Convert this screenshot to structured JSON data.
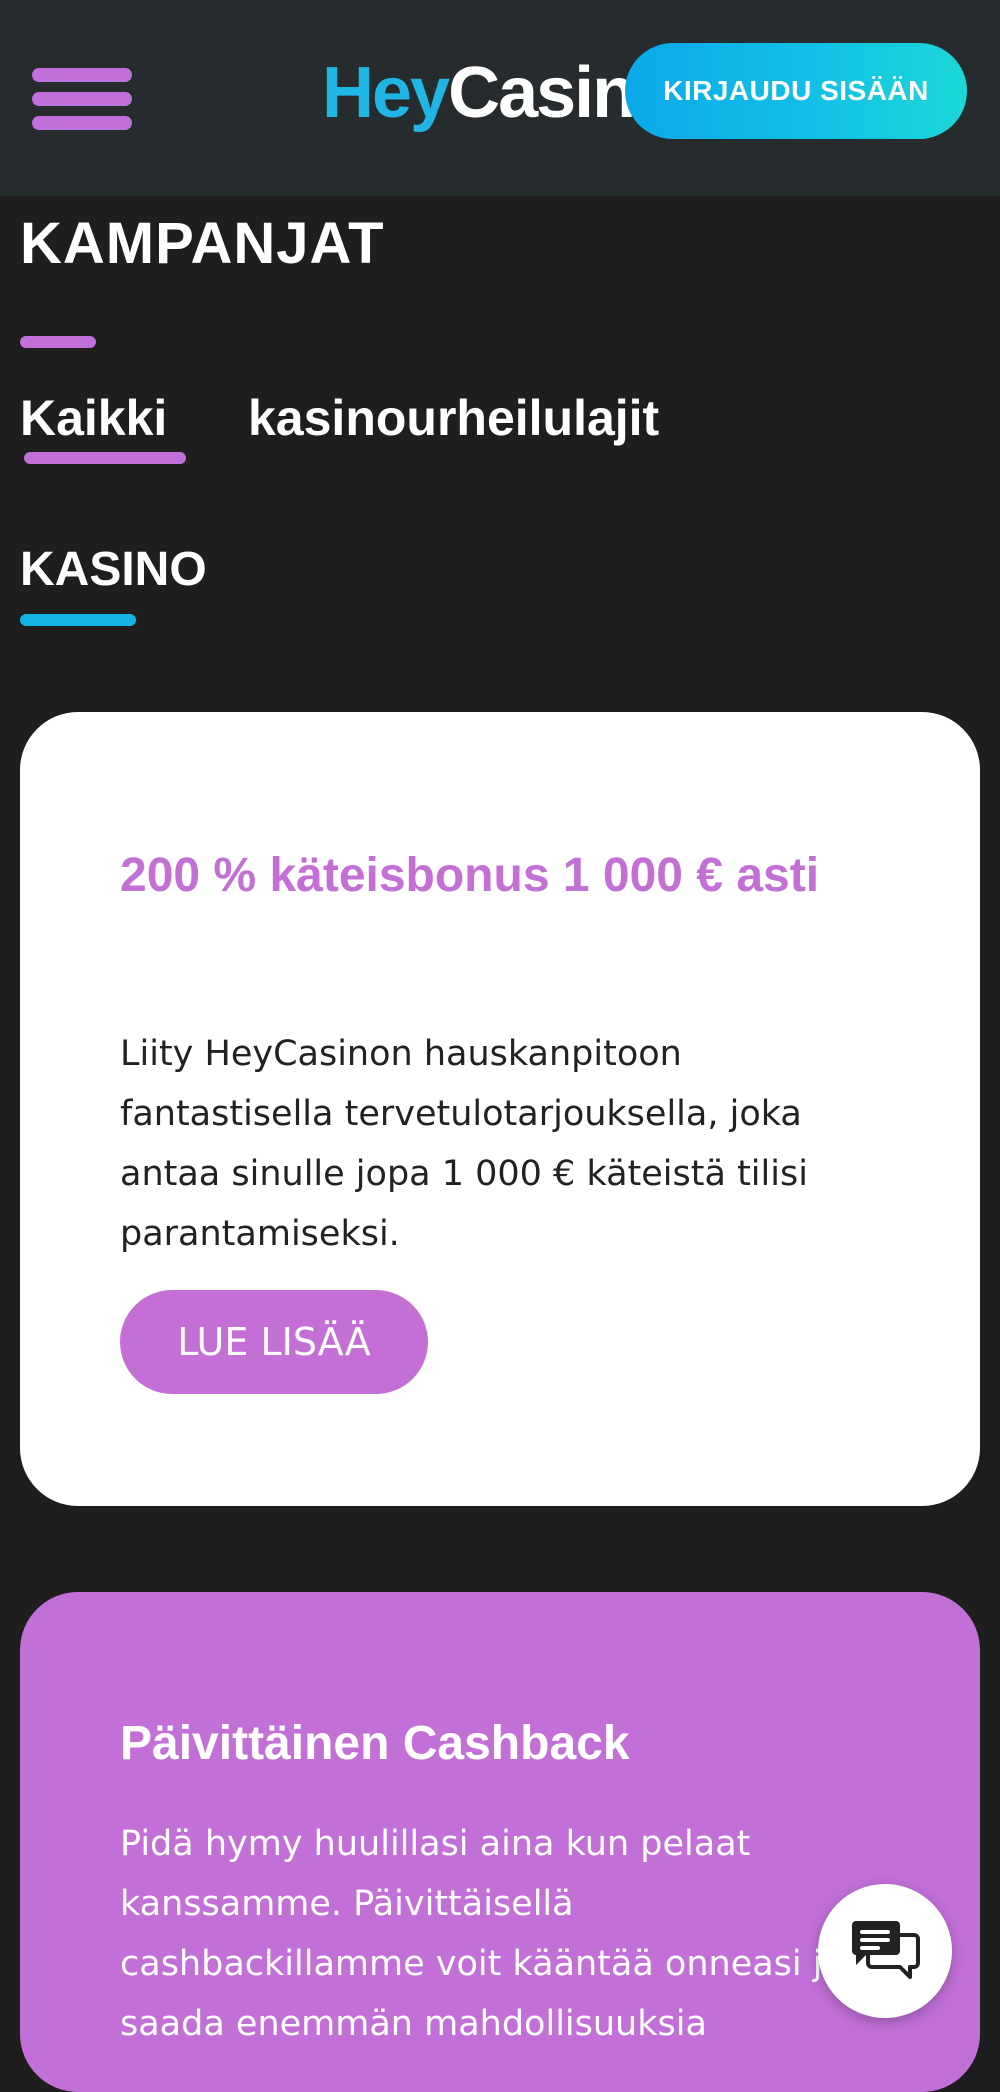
{
  "header": {
    "logo_hey": "Hey",
    "logo_casino": "Casino",
    "login_label": "KIRJAUDU SISÄÄN",
    "menu_icon": "hamburger-menu-icon"
  },
  "page": {
    "title": "KAMPANJAT"
  },
  "tabs": [
    {
      "label": "Kaikki",
      "active": true
    },
    {
      "label": "kasinourheilulajit",
      "active": false
    }
  ],
  "section": {
    "title": "KASINO"
  },
  "promotions": [
    {
      "title": "200 % käteisbonus 1 000 € asti",
      "text": "Liity HeyCasinon hauskanpitoon fantastisella tervetulotarjouksella, joka antaa sinulle jopa 1 000 € käteistä tilisi parantamiseksi.",
      "button_label": "LUE LISÄÄ"
    },
    {
      "title": "Päivittäinen Cashback",
      "text": "Pidä hymy huulillasi aina kun pelaat kanssamme. Päivittäisellä cashbackillamme voit kääntää onneasi ja saada enemmän mahdollisuuksia"
    }
  ],
  "chat": {
    "icon": "chat-bubbles-icon"
  },
  "colors": {
    "header_bg": "#262b2e",
    "page_bg": "#1e1e1e",
    "accent_purple": "#c36fd6",
    "accent_cyan": "#14b4e4",
    "card_white": "#ffffff",
    "card_purple": "#c270d8"
  }
}
